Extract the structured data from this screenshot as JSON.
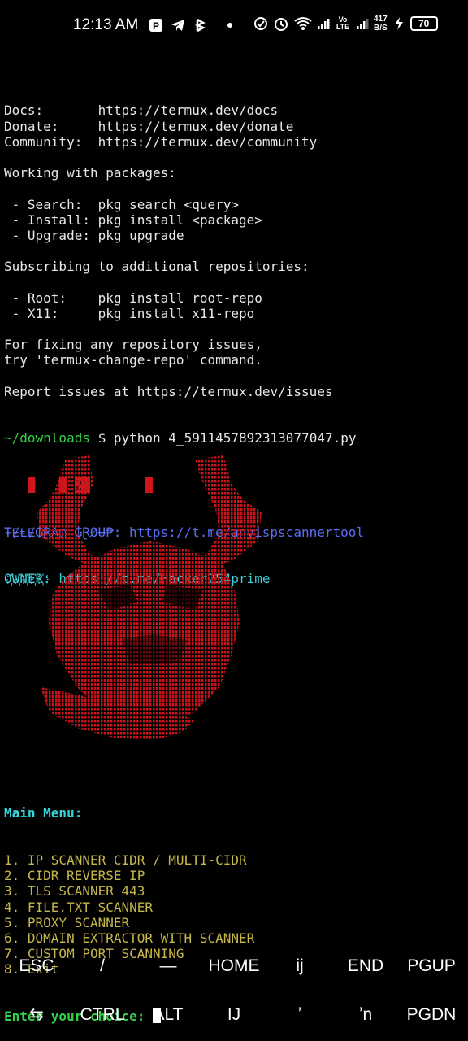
{
  "status_bar": {
    "time": "12:13 AM",
    "net_speed_top": "417",
    "net_speed_bottom": "B/S",
    "volte": "Vo LTE",
    "battery": "70"
  },
  "terminal": {
    "lines": [
      "Docs:       https://termux.dev/docs",
      "Donate:     https://termux.dev/donate",
      "Community:  https://termux.dev/community",
      "",
      "Working with packages:",
      "",
      " - Search:  pkg search <query>",
      " - Install: pkg install <package>",
      " - Upgrade: pkg upgrade",
      "",
      "Subscribing to additional repositories:",
      "",
      " - Root:    pkg install root-repo",
      " - X11:     pkg install x11-repo",
      "",
      "For fixing any repository issues,",
      "try 'termux-change-repo' command.",
      "",
      "Report issues at https://termux.dev/issues"
    ],
    "prompt_path": "~/downloads",
    "prompt_cmd": " $ python 4_5911457892313077047.py",
    "banner_red": "███ ███ █2 ███████ ███████",
    "telegram_line": "ŦɆⱠɆ₲Ɽ₳₥ ₲ⱤØɄ₱: https://t.me/anyispscannertool",
    "owner_line": "O҉W҉N҉E҉R҉: https://t.me/Hacker254prime"
  },
  "menu": {
    "title": "Main Menu:",
    "items": [
      "1. IP SCANNER CIDR / MULTI-CIDR",
      "2. CIDR REVERSE IP",
      "3. TLS SCANNER 443",
      "4. FILE.TXT SCANNER",
      "5. PROXY SCANNER",
      "6. DOMAIN EXTRACTOR WITH SCANNER",
      "7. CUSTOM PORT SCANNING",
      "8. Exit"
    ],
    "prompt": "Enter your choice: "
  },
  "extra_keys": {
    "row1": [
      "ESC",
      "/",
      "—",
      "HOME",
      "ij",
      "END",
      "PGUP"
    ],
    "row2": [
      "⇆",
      "CTRL",
      "ALT",
      "IJ",
      "ʼ",
      "ʼn",
      "PGDN"
    ]
  },
  "colors": {
    "background": "#000000",
    "prompt_green": "#33d04a",
    "banner_red": "#d0151b",
    "menu_cyan": "#33d6da",
    "menu_item": "#c6b64a",
    "telegram_blue": "#5b6ef2"
  }
}
